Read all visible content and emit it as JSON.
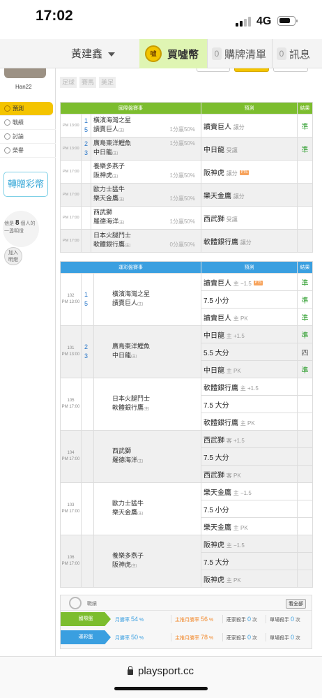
{
  "status": {
    "time": "17:02",
    "network": "4G"
  },
  "nav": {
    "user": "黃建鑫",
    "buy": "買噓幣",
    "coin": "噓",
    "cart_count": "0",
    "cart": "購牌清單",
    "msg_count": "0",
    "msg": "訊息"
  },
  "sidebar": {
    "username": "Han22",
    "menu": [
      {
        "label": "預測"
      },
      {
        "label": "戰績"
      },
      {
        "label": "討論"
      },
      {
        "label": "榮譽"
      }
    ],
    "gift": "轉贈彩幣",
    "bulb_pre": "他是",
    "bulb_num": "8",
    "bulb_post": "個人的",
    "bulb_line2": "一盞明燈",
    "join1": "加入",
    "join2": "明燈"
  },
  "filters": [
    "足球",
    "賽馬",
    "美足"
  ],
  "intl": {
    "header": [
      "國際盤賽事",
      "預測",
      "結果"
    ],
    "rows": [
      {
        "time": "PM 13:00",
        "n1": "1",
        "n2": "5",
        "t1": "橫濱海灣之星",
        "t2": "讀賣巨人",
        "t2s": "(主)",
        "h1": "",
        "h2": "1分贏50%",
        "pred": "讀賣巨人",
        "pg": "讓分",
        "tag": "",
        "res": "準"
      },
      {
        "time": "PM 13:00",
        "n1": "2",
        "n2": "3",
        "t1": "廣島東洋鯉魚",
        "t2": "中日龍",
        "t2s": "(主)",
        "h1": "1分贏50%",
        "h2": "",
        "pred": "中日龍",
        "pg": "受讓",
        "tag": "",
        "res": "準"
      },
      {
        "time": "PM 17:00",
        "n1": "",
        "n2": "",
        "t1": "養樂多燕子",
        "t2": "阪神虎",
        "t2s": "(主)",
        "h1": "",
        "h2": "1分贏50%",
        "pred": "阪神虎",
        "pg": "讓分",
        "tag": "PTS",
        "res": ""
      },
      {
        "time": "PM 17:00",
        "n1": "",
        "n2": "",
        "t1": "歐力士猛牛",
        "t2": "樂天金鷹",
        "t2s": "(主)",
        "h1": "",
        "h2": "1分贏50%",
        "pred": "樂天金鷹",
        "pg": "讓分",
        "tag": "",
        "res": ""
      },
      {
        "time": "PM 17:00",
        "n1": "",
        "n2": "",
        "t1": "西武獅",
        "t2": "羅德海洋",
        "t2s": "(主)",
        "h1": "",
        "h2": "1分贏50%",
        "pred": "西武獅",
        "pg": "受讓",
        "tag": "",
        "res": ""
      },
      {
        "time": "PM 17:00",
        "n1": "",
        "n2": "",
        "t1": "日本火腿鬥士",
        "t2": "軟體銀行鷹",
        "t2s": "(主)",
        "h1": "",
        "h2": "0分贏50%",
        "pred": "軟體銀行鷹",
        "pg": "讓分",
        "tag": "",
        "res": ""
      }
    ]
  },
  "lottery": {
    "header": [
      "運彩盤賽事",
      "預測",
      "結果"
    ],
    "games": [
      {
        "id": "102",
        "time": "PM 13:00",
        "n1": "1",
        "n2": "5",
        "t1": "橫濱海灣之星",
        "t2": "讀賣巨人",
        "t2s": "(主)",
        "preds": [
          {
            "p": "讀賣巨人",
            "g": "主 −1.5",
            "tag": "PTS",
            "r": "準"
          },
          {
            "p": "7.5 小分",
            "g": "",
            "tag": "",
            "r": "準"
          },
          {
            "p": "讀賣巨人",
            "g": "主 PK",
            "tag": "",
            "r": "準"
          }
        ]
      },
      {
        "id": "101",
        "time": "PM 13:00",
        "n1": "2",
        "n2": "3",
        "t1": "廣島東洋鯉魚",
        "t2": "中日龍",
        "t2s": "(主)",
        "preds": [
          {
            "p": "中日龍",
            "g": "主 +1.5",
            "tag": "",
            "r": "準"
          },
          {
            "p": "5.5 大分",
            "g": "",
            "tag": "",
            "r": "四"
          },
          {
            "p": "中日龍",
            "g": "主 PK",
            "tag": "",
            "r": "準"
          }
        ]
      },
      {
        "id": "105",
        "time": "PM 17:00",
        "n1": "",
        "n2": "",
        "t1": "日本火腿鬥士",
        "t2": "軟體銀行鷹",
        "t2s": "(主)",
        "preds": [
          {
            "p": "軟體銀行鷹",
            "g": "主 +1.5",
            "tag": "",
            "r": ""
          },
          {
            "p": "7.5 大分",
            "g": "",
            "tag": "",
            "r": ""
          },
          {
            "p": "軟體銀行鷹",
            "g": "主 PK",
            "tag": "",
            "r": ""
          }
        ]
      },
      {
        "id": "104",
        "time": "PM 17:00",
        "n1": "",
        "n2": "",
        "t1": "西武獅",
        "t2": "羅德海洋",
        "t2s": "(主)",
        "preds": [
          {
            "p": "西武獅",
            "g": "客 +1.5",
            "tag": "",
            "r": ""
          },
          {
            "p": "7.5 大分",
            "g": "",
            "tag": "",
            "r": ""
          },
          {
            "p": "西武獅",
            "g": "客 PK",
            "tag": "",
            "r": ""
          }
        ]
      },
      {
        "id": "103",
        "time": "PM 17:00",
        "n1": "",
        "n2": "",
        "t1": "歐力士猛牛",
        "t2": "樂天金鷹",
        "t2s": "(主)",
        "preds": [
          {
            "p": "樂天金鷹",
            "g": "主 −1.5",
            "tag": "",
            "r": ""
          },
          {
            "p": "7.5 小分",
            "g": "",
            "tag": "",
            "r": ""
          },
          {
            "p": "樂天金鷹",
            "g": "主 PK",
            "tag": "",
            "r": ""
          }
        ]
      },
      {
        "id": "106",
        "time": "PM 17:00",
        "n1": "",
        "n2": "",
        "t1": "養樂多燕子",
        "t2": "阪神虎",
        "t2s": "(主)",
        "preds": [
          {
            "p": "阪神虎",
            "g": "主 −1.5",
            "tag": "",
            "r": ""
          },
          {
            "p": "7.5 大分",
            "g": "",
            "tag": "",
            "r": ""
          },
          {
            "p": "阪神虎",
            "g": "主 PK",
            "tag": "",
            "r": ""
          }
        ]
      }
    ]
  },
  "stats": {
    "label": "戰績",
    "view_all": "看全部",
    "rows": [
      {
        "key": "國際盤",
        "color": "#7cbd2e",
        "m_lbl": "月勝率",
        "m_val": "54",
        "pct": "%",
        "s_lbl": "主推月勝率",
        "s_val": "56",
        "s_pct": "%",
        "z_lbl": "莊家殺手",
        "z_val": "0",
        "z_unit": "次",
        "d_lbl": "單場殺手",
        "d_val": "0",
        "d_unit": "次"
      },
      {
        "key": "運彩盤",
        "color": "#3a9fe0",
        "m_lbl": "月勝率",
        "m_val": "50",
        "pct": "%",
        "s_lbl": "主推月勝率",
        "s_val": "78",
        "s_pct": "%",
        "z_lbl": "莊家殺手",
        "z_val": "0",
        "z_unit": "次",
        "d_lbl": "單場殺手",
        "d_val": "0",
        "d_unit": "次"
      }
    ]
  },
  "browser": {
    "url": "playsport.cc"
  },
  "colors": {
    "green": "#7cbd2e",
    "blue": "#3a9fe0",
    "accent": "#f4c400",
    "hit": "#2e9e2e"
  }
}
